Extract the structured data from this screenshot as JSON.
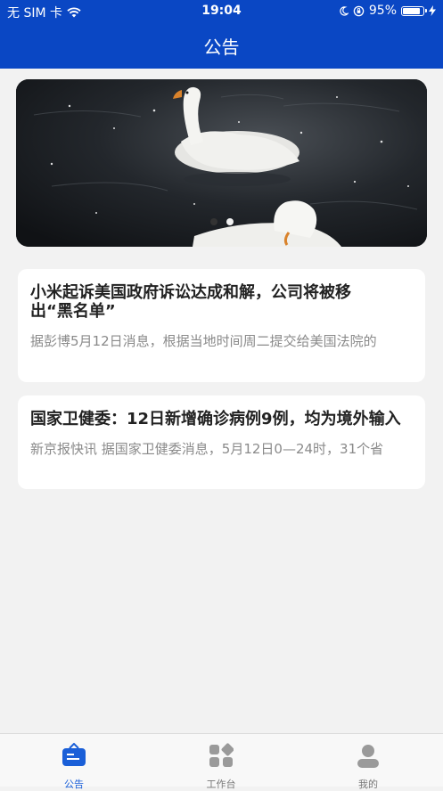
{
  "status_bar": {
    "carrier": "无 SIM 卡",
    "time": "19:04",
    "battery": "95%",
    "battery_level": 0.95
  },
  "header": {
    "title": "公告"
  },
  "banner": {
    "slide_count": 2,
    "active_index": 1
  },
  "news": [
    {
      "title": "小米起诉美国政府诉讼达成和解，公司将被移出“黑名单”",
      "summary": "据彭博5月12日消息，根据当地时间周二提交给美国法院的"
    },
    {
      "title": "国家卫健委：12日新增确诊病例9例，均为境外输入",
      "summary": "新京报快讯 据国家卫健委消息，5月12日0—24时，31个省"
    }
  ],
  "tabbar": {
    "tabs": [
      {
        "label": "公告",
        "icon": "announcement-icon",
        "active": true
      },
      {
        "label": "工作台",
        "icon": "workbench-icon",
        "active": false
      },
      {
        "label": "我的",
        "icon": "profile-icon",
        "active": false
      }
    ]
  },
  "colors": {
    "header": "#0a47c4",
    "accent": "#1a5fd8",
    "background": "#f2f2f2"
  }
}
